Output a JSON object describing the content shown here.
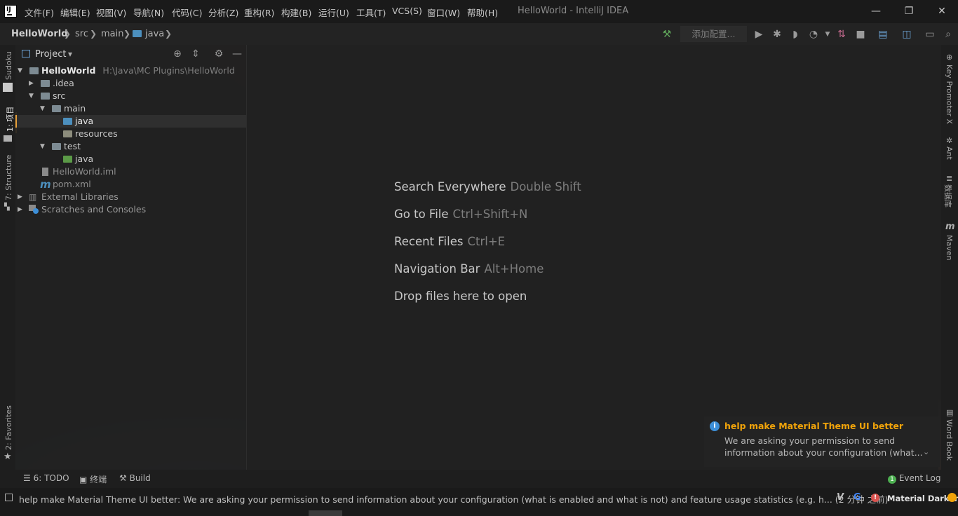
{
  "window": {
    "title": "HelloWorld - IntelliJ IDEA",
    "app_icon_text": "IJ"
  },
  "menu": [
    "文件(F)",
    "编辑(E)",
    "视图(V)",
    "导航(N)",
    "代码(C)",
    "分析(Z)",
    "重构(R)",
    "构建(B)",
    "运行(U)",
    "工具(T)",
    "VCS(S)",
    "窗口(W)",
    "帮助(H)"
  ],
  "window_controls": {
    "minimize": "—",
    "restore": "❐",
    "close": "✕"
  },
  "breadcrumb": [
    "HelloWorld",
    "src",
    "main",
    "java"
  ],
  "breadcrumb_sep": "❯",
  "toolbar": {
    "add_config": "添加配置..."
  },
  "left_stripe": {
    "sudoku": "Sudoku",
    "project": "1: 项目",
    "structure": "7: Structure",
    "favorites": "2: Favorites"
  },
  "project_panel": {
    "title": "Project",
    "dropdown": "▾"
  },
  "tree": {
    "root_name": "HelloWorld",
    "root_path": "H:\\Java\\MC Plugins\\HelloWorld",
    "idea": ".idea",
    "src": "src",
    "main": "main",
    "main_java": "java",
    "resources": "resources",
    "test": "test",
    "test_java": "java",
    "iml": "HelloWorld.iml",
    "pom": "pom.xml",
    "pom_icon": "m",
    "external_libraries": "External Libraries",
    "scratches": "Scratches and Consoles"
  },
  "editor_hints": [
    {
      "label": "Search Everywhere",
      "key": "Double Shift"
    },
    {
      "label": "Go to File",
      "key": "Ctrl+Shift+N"
    },
    {
      "label": "Recent Files",
      "key": "Ctrl+E"
    },
    {
      "label": "Navigation Bar",
      "key": "Alt+Home"
    },
    {
      "label": "Drop files here to open",
      "key": ""
    }
  ],
  "right_stripe": {
    "key_promoter": "Key Promoter X",
    "ant": "Ant",
    "database": "数据库",
    "maven": "Maven",
    "word": "Word Book",
    "maven_icon": "m"
  },
  "notification": {
    "title": "help make Material Theme UI better",
    "line1": "We are asking your permission to send",
    "line2": "information about your configuration (what..."
  },
  "bottom_tools": {
    "todo": "6: TODO",
    "terminal": "终端",
    "build": "Build",
    "event_log": "Event Log"
  },
  "status": {
    "message": "help make Material Theme UI better: We are asking your permission to send information about your configuration (what is enabled and what is not) and feature usage statistics (e.g. h... (2 分钟 之前)",
    "theme": "Material Darker"
  },
  "colors": {
    "accent": "#f0a30a",
    "notif_title": "#f0a30a",
    "info_icon": "#3d8fd8",
    "background": "#212121"
  }
}
